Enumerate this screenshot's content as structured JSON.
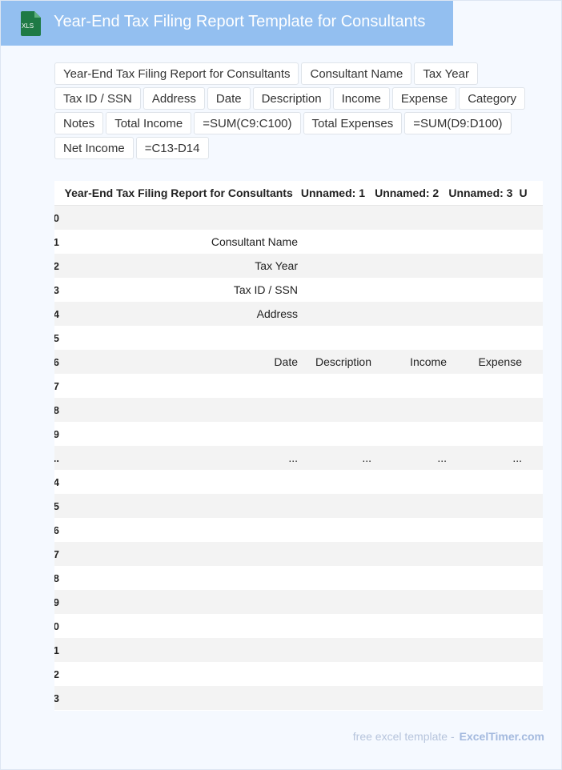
{
  "header": {
    "title": "Year-End Tax Filing Report Template for Consultants",
    "icon_label": "XLS",
    "icon": "xls-file-icon"
  },
  "chips": [
    "Year-End Tax Filing Report for Consultants",
    "Consultant Name",
    "Tax Year",
    "Tax ID / SSN",
    "Address",
    "Date",
    "Description",
    "Income",
    "Expense",
    "Category",
    "Notes",
    "Total Income",
    "=SUM(C9:C100)",
    "Total Expenses",
    "=SUM(D9:D100)",
    "Net Income",
    "=C13-D14"
  ],
  "table": {
    "columns": [
      "Year-End Tax Filing Report for Consultants",
      "Unnamed: 1",
      "Unnamed: 2",
      "Unnamed: 3",
      "U"
    ],
    "rows": [
      {
        "idx": "0",
        "cells": [
          "",
          "",
          "",
          ""
        ]
      },
      {
        "idx": "1",
        "cells": [
          "Consultant Name",
          "",
          "",
          ""
        ]
      },
      {
        "idx": "2",
        "cells": [
          "Tax Year",
          "",
          "",
          ""
        ]
      },
      {
        "idx": "3",
        "cells": [
          "Tax ID / SSN",
          "",
          "",
          ""
        ]
      },
      {
        "idx": "4",
        "cells": [
          "Address",
          "",
          "",
          ""
        ]
      },
      {
        "idx": "5",
        "cells": [
          "",
          "",
          "",
          ""
        ]
      },
      {
        "idx": "6",
        "cells": [
          "Date",
          "Description",
          "Income",
          "Expense"
        ]
      },
      {
        "idx": "7",
        "cells": [
          "",
          "",
          "",
          ""
        ]
      },
      {
        "idx": "8",
        "cells": [
          "",
          "",
          "",
          ""
        ]
      },
      {
        "idx": "9",
        "cells": [
          "",
          "",
          "",
          ""
        ]
      },
      {
        "idx": "..",
        "cells": [
          "...",
          "...",
          "...",
          "..."
        ]
      },
      {
        "idx": "4",
        "cells": [
          "",
          "",
          "",
          ""
        ]
      },
      {
        "idx": "5",
        "cells": [
          "",
          "",
          "",
          ""
        ]
      },
      {
        "idx": "6",
        "cells": [
          "",
          "",
          "",
          ""
        ]
      },
      {
        "idx": "7",
        "cells": [
          "",
          "",
          "",
          ""
        ]
      },
      {
        "idx": "8",
        "cells": [
          "",
          "",
          "",
          ""
        ]
      },
      {
        "idx": "9",
        "cells": [
          "",
          "",
          "",
          ""
        ]
      },
      {
        "idx": "0",
        "cells": [
          "",
          "",
          "",
          ""
        ]
      },
      {
        "idx": "1",
        "cells": [
          "",
          "",
          "",
          ""
        ]
      },
      {
        "idx": "2",
        "cells": [
          "",
          "",
          "",
          ""
        ]
      },
      {
        "idx": "3",
        "cells": [
          "",
          "",
          "",
          ""
        ]
      }
    ]
  },
  "footer": {
    "text": "free excel template -",
    "brand": "ExcelTimer.com"
  },
  "colors": {
    "title_bar": "#93bff0",
    "icon_green": "#1e7a45"
  }
}
